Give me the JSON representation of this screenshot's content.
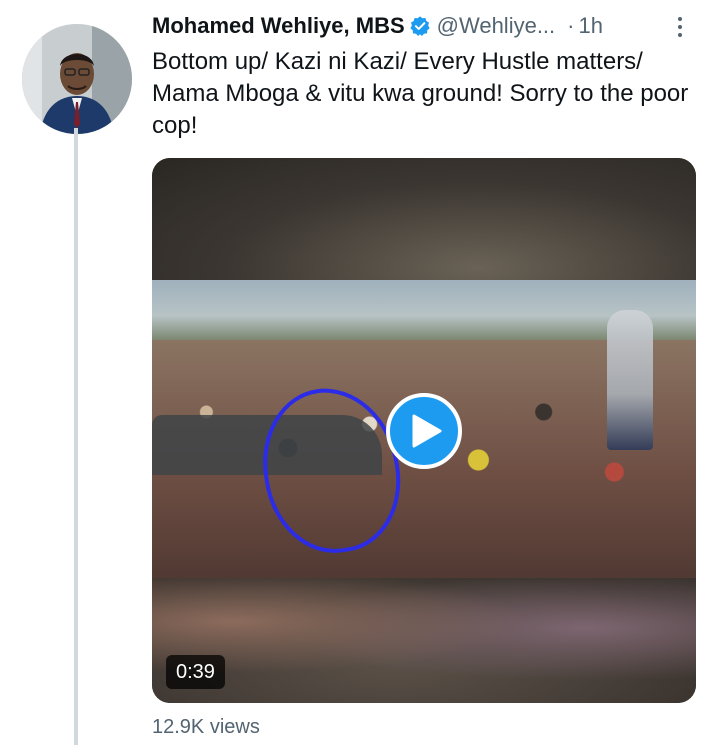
{
  "tweet": {
    "display_name": "Mohamed Wehliye, MBS",
    "handle": "@Wehliye...",
    "separator": "·",
    "time": "1h",
    "text": "Bottom up/ Kazi ni Kazi/ Every  Hustle matters/ Mama Mboga & vitu kwa ground! Sorry to the poor cop!",
    "verified_icon": "verified-badge-icon",
    "more_icon": "more-options-icon"
  },
  "media": {
    "type": "video",
    "duration": "0:39",
    "play_icon": "play-icon"
  },
  "stats": {
    "views": "12.9K views"
  },
  "colors": {
    "accent": "#1d9bf0",
    "text_primary": "#0f1419",
    "text_secondary": "#536471",
    "thread_line": "#cfd9de"
  }
}
